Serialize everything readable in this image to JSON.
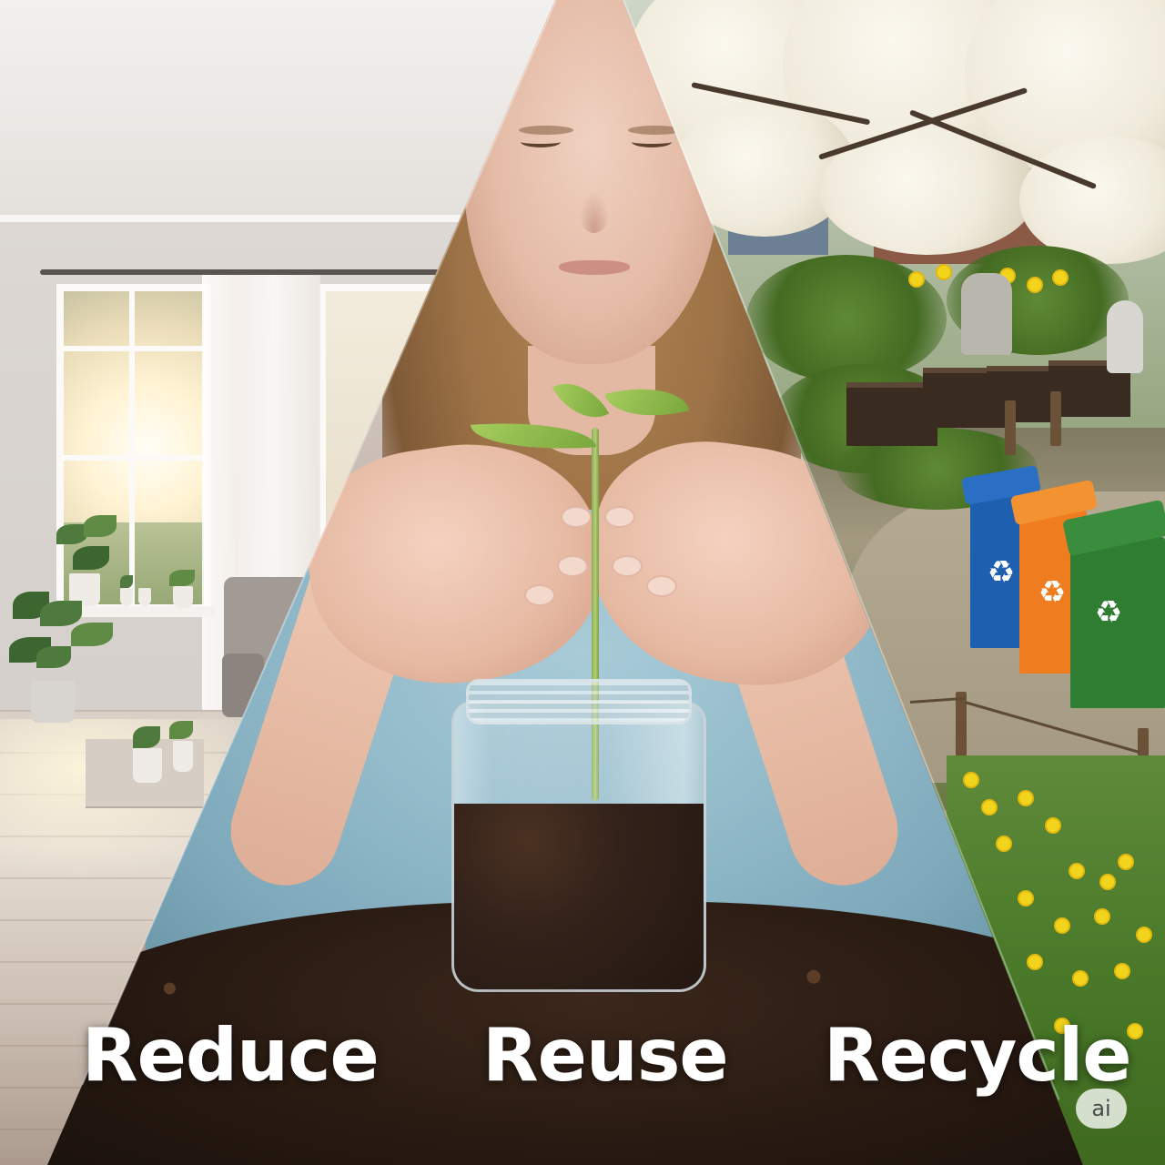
{
  "captions": {
    "left": "Reduce",
    "middle": "Reuse",
    "right": "Recycle"
  },
  "badge": {
    "label": "ai"
  },
  "recycle_symbol": "♻",
  "colors": {
    "caption_text": "#ffffff",
    "bin_blue": "#1f5fb0",
    "bin_orange": "#ef7d1f",
    "bin_green": "#2f7d32",
    "shirt": "#93bbca",
    "soil": "#2b1c13"
  }
}
